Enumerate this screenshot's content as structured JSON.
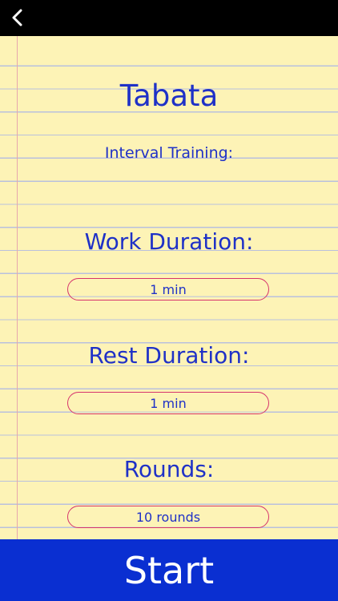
{
  "nav": {
    "back_icon": "chevron-left-icon"
  },
  "screen": {
    "title": "Tabata",
    "subtitle": "Interval Training:"
  },
  "settings": {
    "work": {
      "label": "Work Duration:",
      "value": "1 min"
    },
    "rest": {
      "label": "Rest Duration:",
      "value": "1 min"
    },
    "rounds": {
      "label": "Rounds:",
      "value": "10 rounds"
    }
  },
  "actions": {
    "start_label": "Start"
  },
  "colors": {
    "topbar": "#000000",
    "paper": "#fdf3b6",
    "ruled_line": "#b9c0dd",
    "margin_line": "#e7a7ad",
    "text_blue": "#1f31c7",
    "field_border": "#d6336c",
    "start_button": "#0a2fd1",
    "start_text": "#ffffff"
  }
}
